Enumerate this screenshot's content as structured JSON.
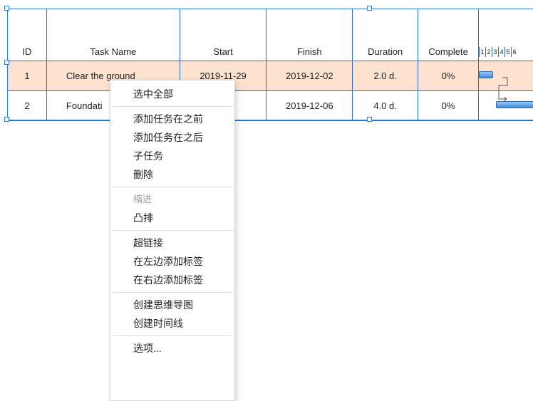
{
  "columns": {
    "id": "ID",
    "task_name": "Task Name",
    "start": "Start",
    "finish": "Finish",
    "duration": "Duration",
    "complete": "Complete"
  },
  "day_scale": [
    "1",
    "2",
    "3",
    "4",
    "5",
    "6"
  ],
  "rows": [
    {
      "id": "1",
      "name": "Clear the ground",
      "start": "2019-11-29",
      "finish": "2019-12-02",
      "duration": "2.0 d.",
      "complete": "0%"
    },
    {
      "id": "2",
      "name": "Foundati",
      "start": "-03",
      "finish": "2019-12-06",
      "duration": "4.0 d.",
      "complete": "0%"
    }
  ],
  "context_menu": {
    "select_all": "选中全部",
    "add_task_before": "添加任务在之前",
    "add_task_after": "添加任务在之后",
    "subtask": "子任务",
    "delete": "删除",
    "indent": "缩进",
    "outdent": "凸排",
    "hyperlink": "超链接",
    "add_label_left": "在左边添加标签",
    "add_label_right": "在右边添加标签",
    "create_mind_map": "创建思维导图",
    "create_timeline": "创建时间线",
    "options": "选项..."
  },
  "colors": {
    "selection_blue": "#2f7fd8",
    "grid_line": "#2b6fc4",
    "selected_row_bg": "#fde2cf",
    "bar_blue": "#3e8be0"
  }
}
